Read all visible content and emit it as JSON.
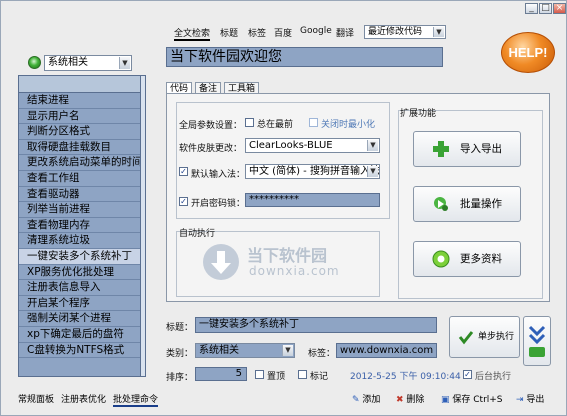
{
  "window": {
    "title_buttons": {
      "minimize": "_",
      "maximize": "□",
      "close": "×"
    }
  },
  "category_select": {
    "value": "系统相关"
  },
  "top_nav": {
    "items": [
      "全文检索",
      "标题",
      "标签",
      "百度",
      "Google",
      "翻译"
    ],
    "active": "全文检索",
    "sort_select": "最近修改代码"
  },
  "header": {
    "title": "当下软件园欢迎您"
  },
  "help_button": {
    "label": "HELP!"
  },
  "list": {
    "items": [
      "结束进程",
      "显示用户名",
      "判断分区格式",
      "取得硬盘挂载数目",
      "更改系统启动菜单的时间",
      "查看工作组",
      "查看驱动器",
      "列举当前进程",
      "查看物理内存",
      "清理系统垃圾",
      "一键安装多个系统补丁",
      "XP服务优化批处理",
      "注册表信息导入",
      "开启某个程序",
      "强制关闭某个进程",
      "xp下确定最后的盘符",
      "C盘转换为NTFS格式"
    ],
    "selected_index": 10
  },
  "tabs": [
    "代码",
    "备注",
    "工具箱"
  ],
  "settings": {
    "global_params_label": "全局参数设置：",
    "always_on_top_label": "总在最前",
    "minimize_on_close_label": "关闭时最小化",
    "skin_label": "软件皮肤更改：",
    "skin_value": "ClearLooks-BLUE",
    "default_ime_label": "默认输入法：",
    "default_ime_value": "中文 (简体) - 搜狗拼音输入法",
    "password_label": "开启密码锁：",
    "password_value": "**********",
    "autorun_label": "自动执行",
    "extensions_label": "扩展功能"
  },
  "ext_buttons": {
    "import_export": "导入导出",
    "batch": "批量操作",
    "more": "更多资料"
  },
  "watermark": {
    "cn": "当下软件园",
    "url": "downxia.com"
  },
  "form": {
    "title_label": "标题：",
    "title_value": "一键安装多个系统补丁",
    "category_label": "类别：",
    "category_value": "系统相关",
    "tags_label": "标签：",
    "tags_value": "www.downxia.com",
    "order_label": "排序：",
    "order_value": "5",
    "pin_label": "置顶",
    "mark_label": "标记",
    "timestamp": "2012-5-25 下午 09:10:44",
    "background_exec_label": "后台执行",
    "single_step_label": "单步执行"
  },
  "bottom_tabs": [
    "常规面板",
    "注册表优化",
    "批处理命令"
  ],
  "bottom_tab_active": "批处理命令",
  "toolbar": {
    "add": "添加",
    "delete": "删除",
    "save": "保存 Ctrl+S",
    "export": "导出"
  },
  "colors": {
    "accent_list": "#8ea4c4",
    "help": "#f08a25"
  }
}
